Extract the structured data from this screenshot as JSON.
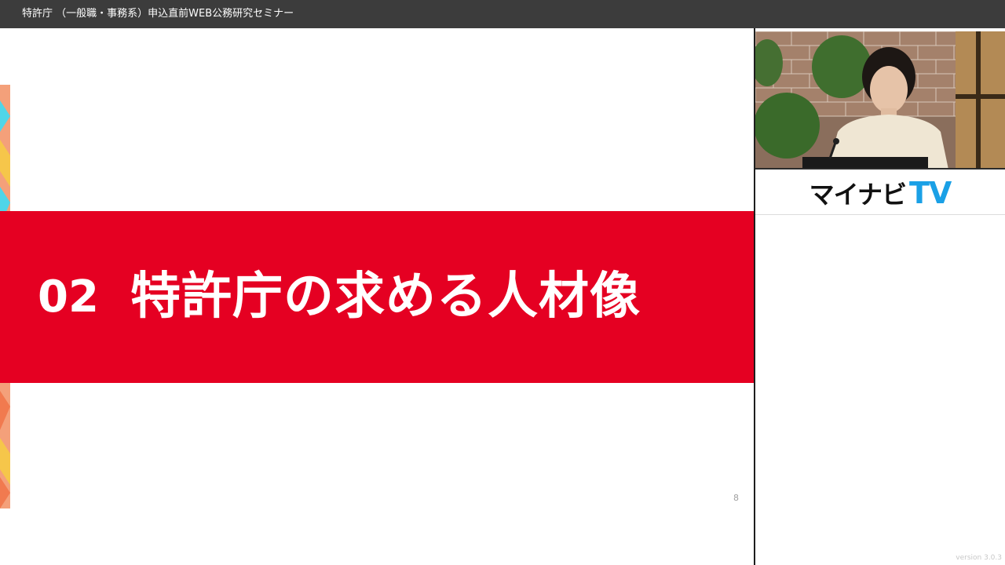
{
  "window": {
    "title": "特許庁 （一般職・事務系）申込直前WEB公務研究セミナー"
  },
  "slide": {
    "section_number": "02",
    "section_title": "特許庁の求める人材像",
    "page_number": "8",
    "band_color": "#e50022"
  },
  "side_panel": {
    "logo_main": "マイナビ",
    "logo_accent": "TV",
    "logo_accent_color": "#1aa0e6",
    "version": "version 3.0.3"
  }
}
